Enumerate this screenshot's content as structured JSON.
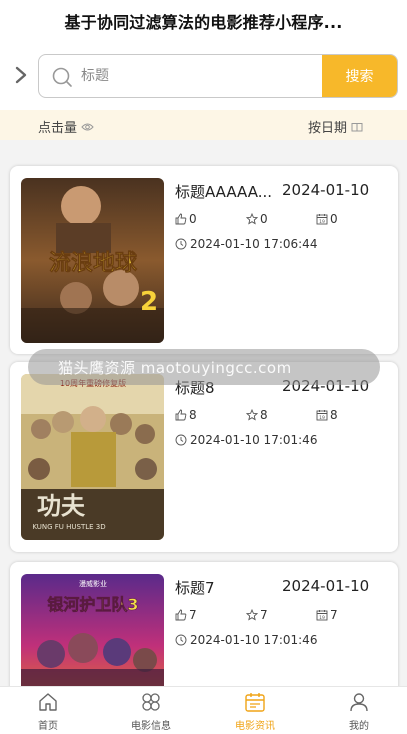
{
  "header": {
    "title": "基于协同过滤算法的电影推荐小程序..."
  },
  "search": {
    "placeholder": "标题",
    "button_label": "搜索"
  },
  "sort": {
    "left_label": "点击量",
    "right_label": "按日期"
  },
  "cards": [
    {
      "title": "标题AAAAA...",
      "date": "2024-01-10",
      "likes": "0",
      "favorites": "0",
      "clicks": "0",
      "timestamp": "2024-01-10 17:06:44",
      "poster_text": "流浪地球",
      "poster_sub": "2"
    },
    {
      "title": "标题8",
      "date": "2024-01-10",
      "likes": "8",
      "favorites": "8",
      "clicks": "8",
      "timestamp": "2024-01-10 17:01:46",
      "poster_text": "功夫",
      "poster_sub": "KUNG FU HUSTLE 3D",
      "poster_top": "10周年重磅修复版"
    },
    {
      "title": "标题7",
      "date": "2024-01-10",
      "likes": "7",
      "favorites": "7",
      "clicks": "7",
      "timestamp": "2024-01-10 17:01:46",
      "poster_text": "银河护卫队3",
      "poster_top": "漫威影业"
    }
  ],
  "toast": {
    "text": "猫头鹰资源 maotouyingcc.com"
  },
  "tabbar": {
    "items": [
      {
        "label": "首页",
        "icon": "home-icon"
      },
      {
        "label": "电影信息",
        "icon": "grid-icon"
      },
      {
        "label": "电影资讯",
        "icon": "calendar-icon"
      },
      {
        "label": "我的",
        "icon": "user-icon"
      }
    ]
  },
  "colors": {
    "accent": "#f7b82a",
    "active_tab": "#f0a416",
    "sort_bg": "#fdf6e6"
  }
}
